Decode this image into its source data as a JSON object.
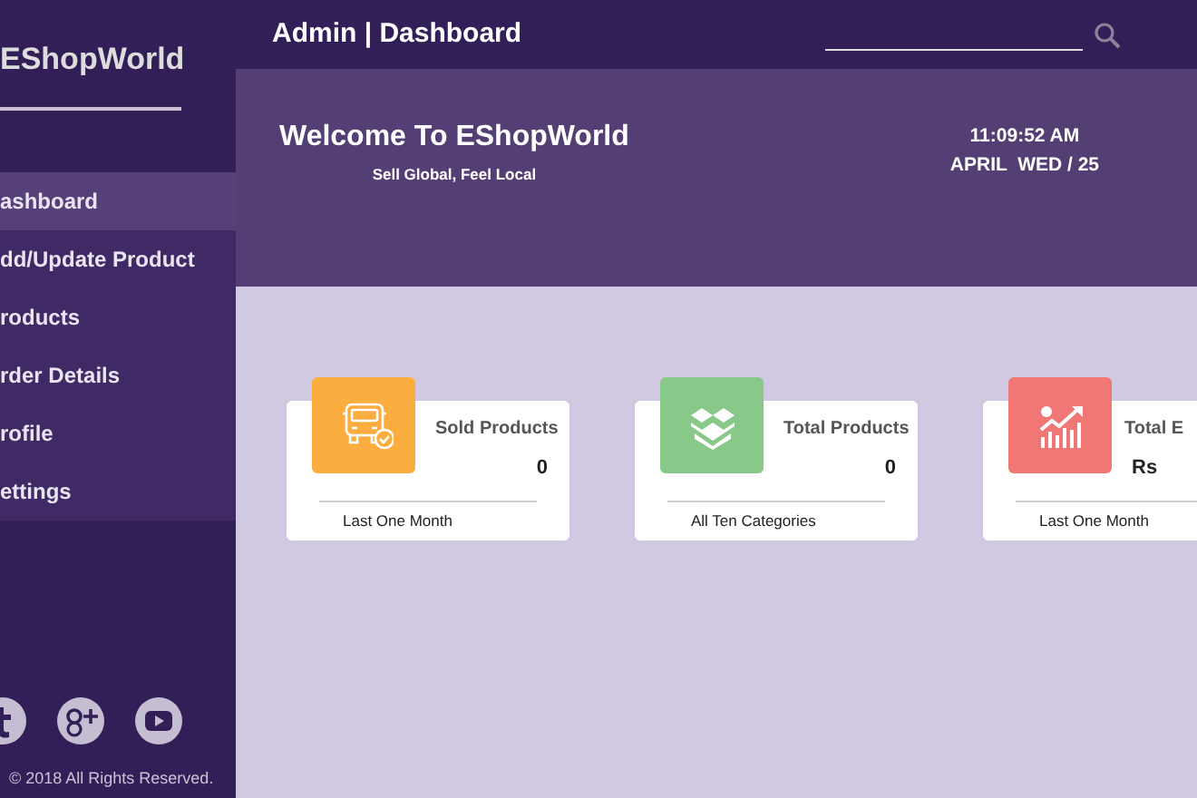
{
  "sidebar": {
    "logo": "EShopWorld",
    "items": [
      {
        "label": "ashboard",
        "selected": true
      },
      {
        "label": "dd/Update Product",
        "selected": false
      },
      {
        "label": "roducts",
        "selected": false
      },
      {
        "label": "rder Details",
        "selected": false
      },
      {
        "label": "rofile",
        "selected": false
      },
      {
        "label": "ettings",
        "selected": false
      }
    ],
    "social": [
      {
        "kind": "tumblr"
      },
      {
        "kind": "gplus"
      },
      {
        "kind": "youtube"
      }
    ],
    "copyright": "© 2018 All Rights Reserved."
  },
  "topbar": {
    "title": "Admin | Dashboard"
  },
  "hero": {
    "title": "Welcome To EShopWorld",
    "subtitle": "Sell Global, Feel Local",
    "time": "11:09:52 AM",
    "date": "APRIL  WED / 25"
  },
  "cards": [
    {
      "kind": "truck",
      "color": "#fcad3f",
      "title": "Sold Products",
      "value": "0",
      "footer": "Last One Month"
    },
    {
      "kind": "box",
      "color": "#88c98a",
      "title": "Total Products",
      "value": "0",
      "footer": "All Ten Categories"
    },
    {
      "kind": "chart",
      "color": "#f07773",
      "title": "Total E",
      "value": "Rs",
      "footer": "Last One Month"
    }
  ]
}
